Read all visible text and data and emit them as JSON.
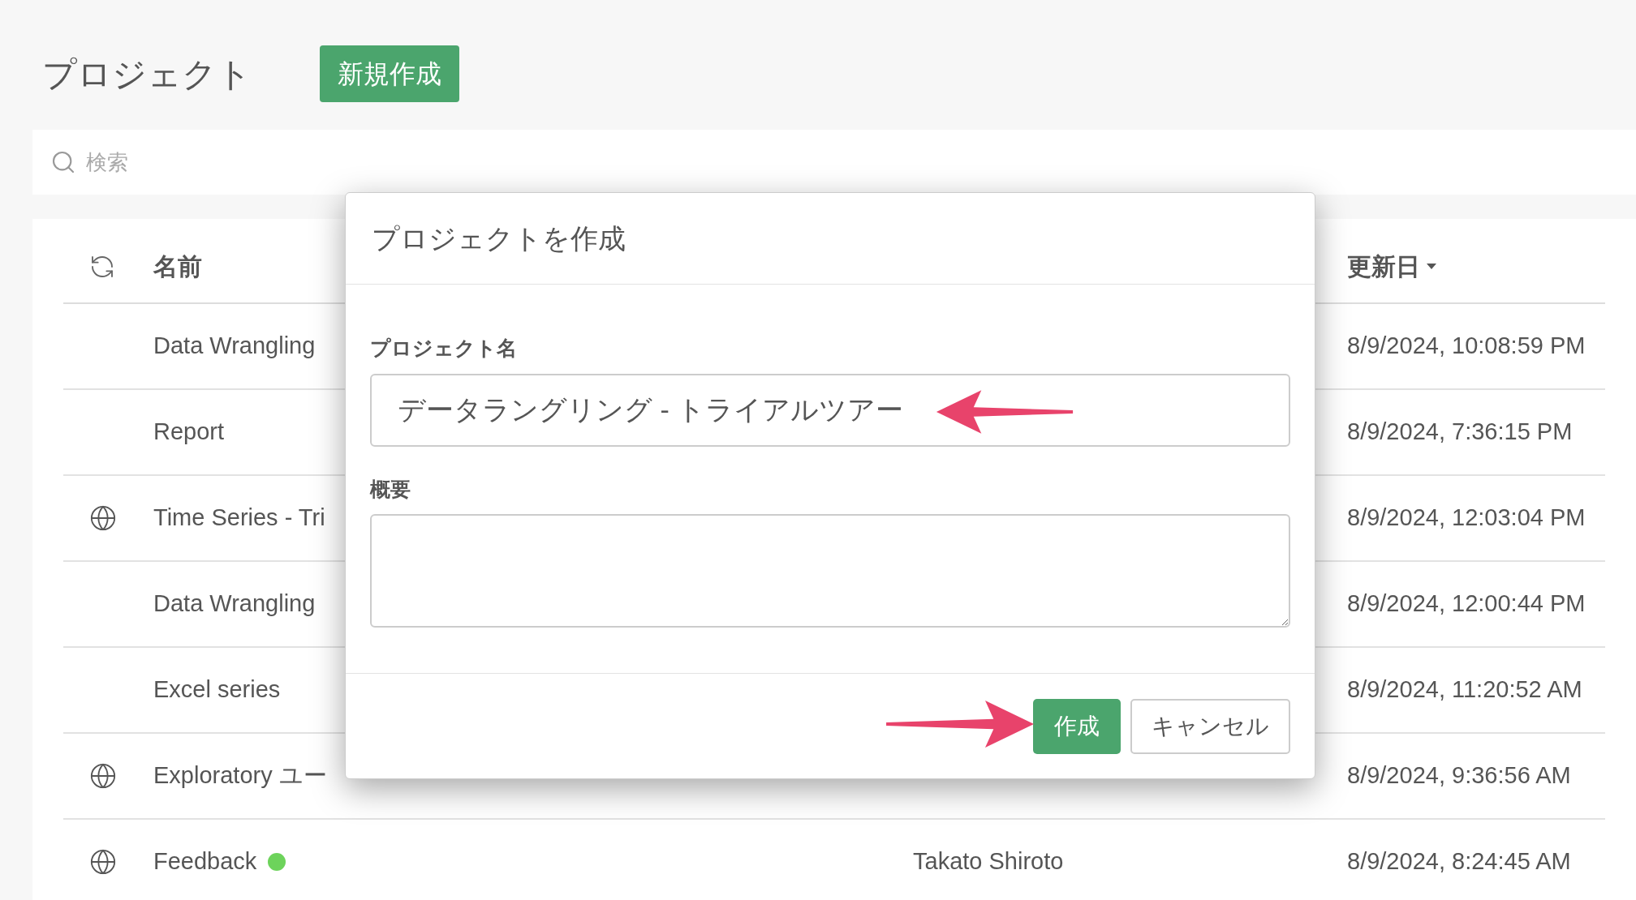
{
  "header": {
    "title": "プロジェクト",
    "new_button": "新規作成"
  },
  "search": {
    "placeholder": "検索"
  },
  "table": {
    "columns": {
      "name": "名前",
      "updated": "更新日"
    },
    "rows": [
      {
        "public": false,
        "name": "Data Wrangling",
        "updated": "8/9/2024, 10:08:59 PM"
      },
      {
        "public": false,
        "name": "Report",
        "updated": "8/9/2024, 7:36:15 PM"
      },
      {
        "public": true,
        "name": "Time Series - Tri",
        "updated": "8/9/2024, 12:03:04 PM"
      },
      {
        "public": false,
        "name": "Data Wrangling",
        "updated": "8/9/2024, 12:00:44 PM"
      },
      {
        "public": false,
        "name": "Excel series",
        "updated": "8/9/2024, 11:20:52 AM"
      },
      {
        "public": true,
        "name": "Exploratory ユー",
        "updated": "8/9/2024, 9:36:56 AM"
      },
      {
        "public": true,
        "name": "Feedback",
        "color": "#6dd35b",
        "owner": "Takato Shiroto",
        "updated": "8/9/2024, 8:24:45 AM"
      }
    ]
  },
  "dialog": {
    "title": "プロジェクトを作成",
    "fields": [
      {
        "kind": "input",
        "label": "プロジェクト名",
        "value": "データラングリング - トライアルツアー"
      },
      {
        "kind": "textarea",
        "label": "概要"
      }
    ],
    "buttons": [
      {
        "kind": "primary",
        "label": "作成"
      },
      {
        "kind": "default",
        "label": "キャンセル"
      }
    ]
  }
}
